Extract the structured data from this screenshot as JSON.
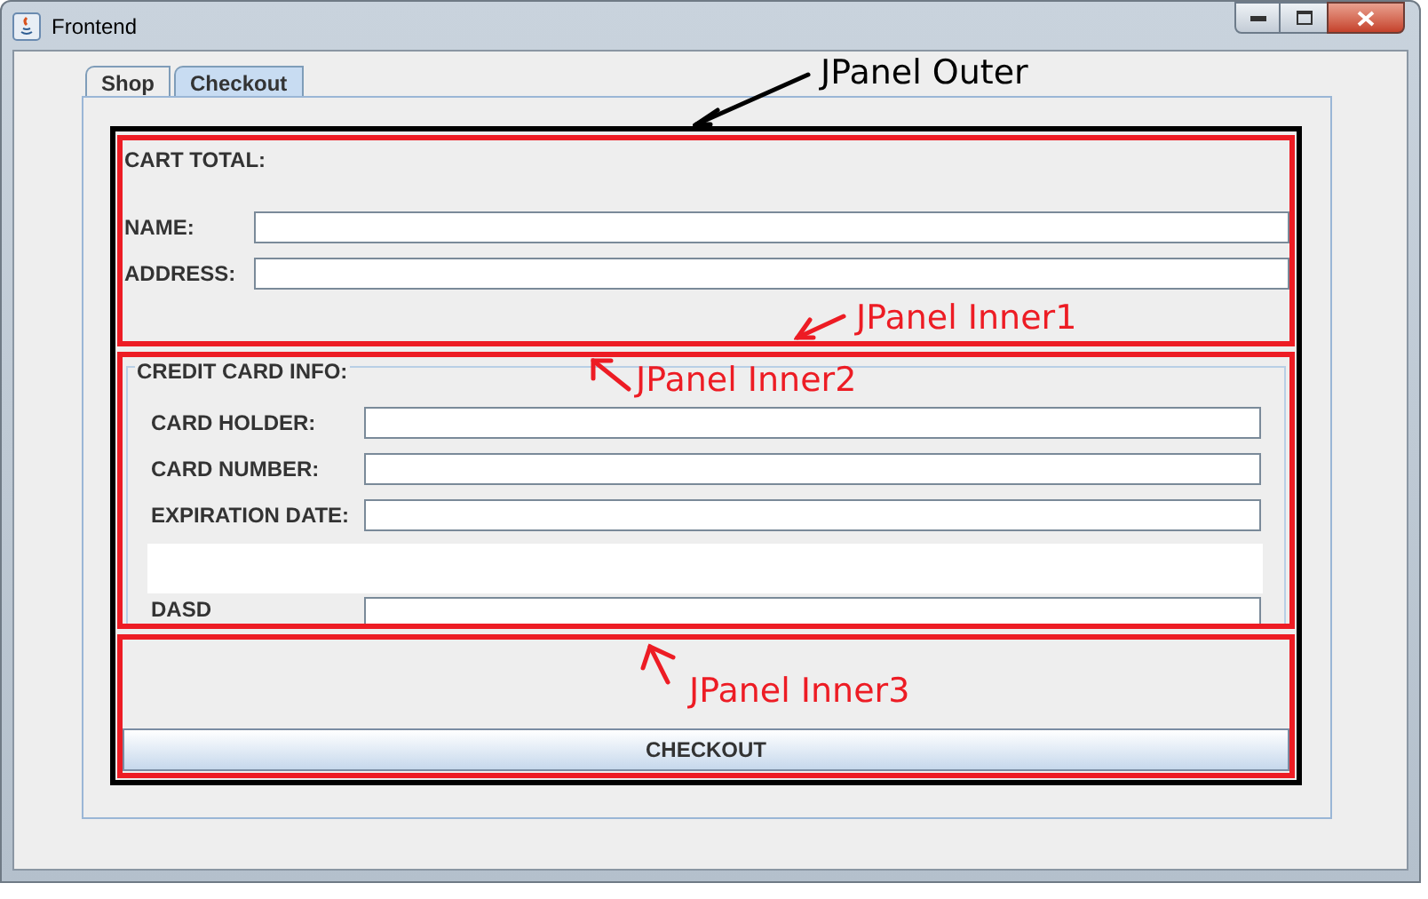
{
  "window": {
    "title": "Frontend"
  },
  "tabs": [
    {
      "label": "Shop",
      "selected": false
    },
    {
      "label": "Checkout",
      "selected": true
    }
  ],
  "cart_panel": {
    "total_label": "CART TOTAL:",
    "fields": [
      {
        "label": "NAME:"
      },
      {
        "label": "ADDRESS:"
      }
    ]
  },
  "credit_card_panel": {
    "title": "CREDIT CARD INFO:",
    "fields": [
      {
        "label": "CARD HOLDER:"
      },
      {
        "label": "CARD NUMBER:"
      },
      {
        "label": "EXPIRATION DATE:"
      }
    ],
    "cut_field": {
      "label": "DASD"
    }
  },
  "checkout_button": {
    "label": "CHECKOUT"
  },
  "annotations": [
    {
      "text": "JPanel Outer",
      "color": "#000000"
    },
    {
      "text": "JPanel Inner1",
      "color": "#ed1c24"
    },
    {
      "text": "JPanel Inner2",
      "color": "#ed1c24"
    },
    {
      "text": "JPanel Inner3",
      "color": "#ed1c24"
    }
  ]
}
